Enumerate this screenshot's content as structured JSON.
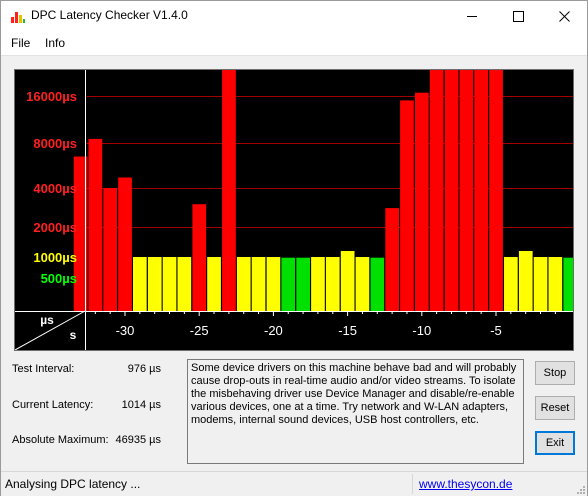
{
  "window": {
    "title": "DPC Latency Checker V1.4.0",
    "minimize_icon": "minimize-icon",
    "maximize_icon": "maximize-icon",
    "close_icon": "close-icon"
  },
  "menu": {
    "items": [
      "File",
      "Info"
    ]
  },
  "chart_data": {
    "type": "bar",
    "xlabel": "s",
    "ylabel": "µs",
    "x_ticks": [
      "-30",
      "-25",
      "-20",
      "-15",
      "-10",
      "-5"
    ],
    "y_ticks": [
      {
        "label": "16000µs",
        "color": "#ff2020"
      },
      {
        "label": "8000µs",
        "color": "#ff2020"
      },
      {
        "label": "4000µs",
        "color": "#ff2020"
      },
      {
        "label": "2000µs",
        "color": "#ff2020"
      },
      {
        "label": "1000µs",
        "color": "#ffff00"
      },
      {
        "label": "500µs",
        "color": "#00ff00"
      }
    ],
    "colors": {
      "red": "#ff0000",
      "yellow": "#ffff00",
      "green": "#00e000"
    },
    "bars": [
      {
        "x": -33,
        "value": 6500,
        "color": "red"
      },
      {
        "x": -32,
        "value": 8500,
        "color": "red"
      },
      {
        "x": -31,
        "value": 4000,
        "color": "red"
      },
      {
        "x": -30,
        "value": 4700,
        "color": "red"
      },
      {
        "x": -29,
        "value": 1000,
        "color": "yellow"
      },
      {
        "x": -28,
        "value": 1000,
        "color": "yellow"
      },
      {
        "x": -27,
        "value": 1000,
        "color": "yellow"
      },
      {
        "x": -26,
        "value": 1000,
        "color": "yellow"
      },
      {
        "x": -25,
        "value": 3000,
        "color": "red"
      },
      {
        "x": -24,
        "value": 1000,
        "color": "yellow"
      },
      {
        "x": -23,
        "value": 46935,
        "color": "red"
      },
      {
        "x": -22,
        "value": 1000,
        "color": "yellow"
      },
      {
        "x": -21,
        "value": 1000,
        "color": "yellow"
      },
      {
        "x": -20,
        "value": 1000,
        "color": "yellow"
      },
      {
        "x": -19,
        "value": 976,
        "color": "green"
      },
      {
        "x": -18,
        "value": 976,
        "color": "green"
      },
      {
        "x": -17,
        "value": 1000,
        "color": "yellow"
      },
      {
        "x": -16,
        "value": 1000,
        "color": "yellow"
      },
      {
        "x": -15,
        "value": 1150,
        "color": "yellow"
      },
      {
        "x": -14,
        "value": 1000,
        "color": "yellow"
      },
      {
        "x": -13,
        "value": 976,
        "color": "green"
      },
      {
        "x": -12,
        "value": 2800,
        "color": "red"
      },
      {
        "x": -11,
        "value": 15000,
        "color": "red"
      },
      {
        "x": -10,
        "value": 16800,
        "color": "red"
      },
      {
        "x": -9,
        "value": 46935,
        "color": "red"
      },
      {
        "x": -8,
        "value": 46935,
        "color": "red"
      },
      {
        "x": -7,
        "value": 46935,
        "color": "red"
      },
      {
        "x": -6,
        "value": 46935,
        "color": "red"
      },
      {
        "x": -5,
        "value": 46935,
        "color": "red"
      },
      {
        "x": -4,
        "value": 1000,
        "color": "yellow"
      },
      {
        "x": -3,
        "value": 1150,
        "color": "yellow"
      },
      {
        "x": -2,
        "value": 1000,
        "color": "yellow"
      },
      {
        "x": -1,
        "value": 1000,
        "color": "yellow"
      },
      {
        "x": 0,
        "value": 976,
        "color": "green"
      }
    ]
  },
  "info": {
    "test_interval_label": "Test Interval:",
    "test_interval_value": "976 µs",
    "current_latency_label": "Current Latency:",
    "current_latency_value": "1014 µs",
    "absolute_maximum_label": "Absolute Maximum:",
    "absolute_maximum_value": "46935 µs"
  },
  "message": "Some device drivers on this machine behave bad and will probably cause drop-outs in real-time audio and/or video streams. To isolate the misbehaving driver use Device Manager and disable/re-enable various devices, one at a time. Try network and W-LAN adapters, modems, internal sound devices, USB host controllers, etc.",
  "buttons": {
    "stop": "Stop",
    "reset": "Reset",
    "exit": "Exit"
  },
  "status": {
    "text": "Analysing DPC latency ...",
    "link": "www.thesycon.de"
  }
}
